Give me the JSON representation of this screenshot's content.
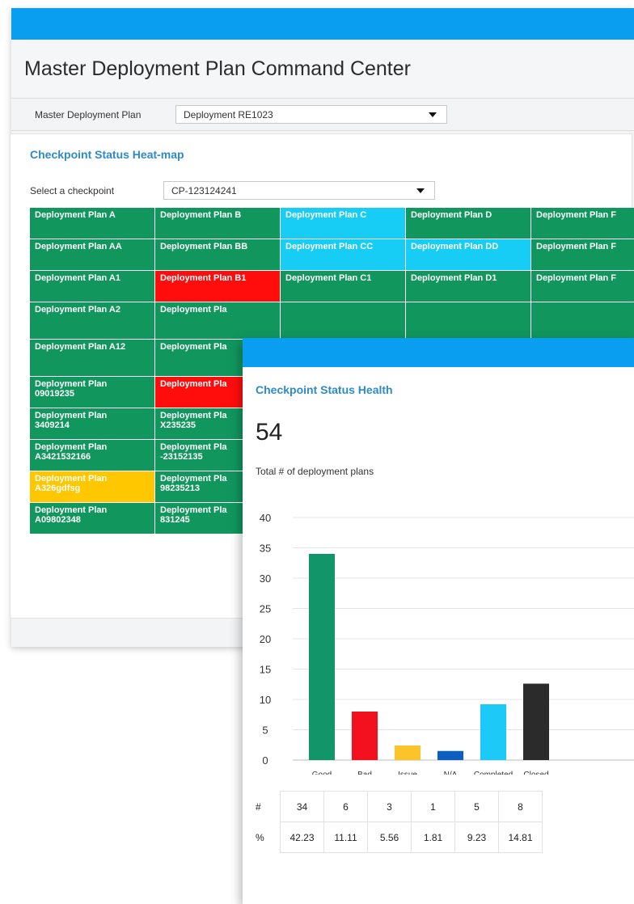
{
  "app": {
    "title": "Master Deployment Plan Command Center"
  },
  "master_plan": {
    "label": "Master Deployment Plan",
    "value": "Deployment RE1023"
  },
  "heatmap": {
    "title": "Checkpoint Status Heat-map",
    "checkpoint_label": "Select a checkpoint",
    "checkpoint_value": "CP-123124241",
    "rows": [
      [
        {
          "t": "Deployment Plan A",
          "c": "g"
        },
        {
          "t": "Deployment Plan B",
          "c": "g"
        },
        {
          "t": "Deployment Plan C",
          "c": "c"
        },
        {
          "t": "Deployment Plan D",
          "c": "g"
        },
        {
          "t": "Deployment Plan F",
          "c": "g"
        }
      ],
      [
        {
          "t": "Deployment Plan AA",
          "c": "g"
        },
        {
          "t": "Deployment Plan BB",
          "c": "g"
        },
        {
          "t": "Deployment Plan CC",
          "c": "c"
        },
        {
          "t": "Deployment Plan DD",
          "c": "c"
        },
        {
          "t": "Deployment Plan F",
          "c": "g"
        }
      ],
      [
        {
          "t": "Deployment Plan A1",
          "c": "g"
        },
        {
          "t": "Deployment Plan B1",
          "c": "r"
        },
        {
          "t": "Deployment Plan C1",
          "c": "g"
        },
        {
          "t": "Deployment Plan D1",
          "c": "g"
        },
        {
          "t": "Deployment Plan F",
          "c": "g"
        }
      ],
      [
        {
          "t": "Deployment Plan A2",
          "c": "g"
        },
        {
          "t": "Deployment Pla",
          "c": "g"
        },
        {
          "t": "",
          "c": "g"
        },
        {
          "t": "",
          "c": "g"
        },
        {
          "t": "",
          "c": "g"
        }
      ],
      [
        {
          "t": "Deployment Plan A12",
          "c": "g"
        },
        {
          "t": "Deployment Pla",
          "c": "g"
        },
        {
          "t": "",
          "c": "g"
        },
        {
          "t": "",
          "c": "g"
        },
        {
          "t": "",
          "c": "g"
        }
      ],
      [
        {
          "t": "Deployment Plan\n09019235",
          "c": "g"
        },
        {
          "t": "Deployment Pla",
          "c": "r"
        },
        {
          "t": "",
          "c": "g"
        },
        {
          "t": "",
          "c": "g"
        },
        {
          "t": "",
          "c": "g"
        }
      ],
      [
        {
          "t": "Deployment Plan\n3409214",
          "c": "g"
        },
        {
          "t": "Deployment Pla\nX235235",
          "c": "g"
        },
        {
          "t": "",
          "c": "g"
        },
        {
          "t": "",
          "c": "g"
        },
        {
          "t": "",
          "c": "g"
        }
      ],
      [
        {
          "t": "Deployment Plan\nA3421532166",
          "c": "g"
        },
        {
          "t": "Deployment Pla\n-23152135",
          "c": "g"
        },
        {
          "t": "",
          "c": "g"
        },
        {
          "t": "",
          "c": "g"
        },
        {
          "t": "",
          "c": "g"
        }
      ],
      [
        {
          "t": "Deployment Plan\nA326gdfsg",
          "c": "y"
        },
        {
          "t": "Deployment Pla\n98235213",
          "c": "g"
        },
        {
          "t": "",
          "c": "g"
        },
        {
          "t": "",
          "c": "g"
        },
        {
          "t": "",
          "c": "g"
        }
      ],
      [
        {
          "t": "Deployment Plan\nA09802348",
          "c": "g"
        },
        {
          "t": "Deployment Pla\n831245",
          "c": "g"
        },
        {
          "t": "",
          "c": "g"
        },
        {
          "t": "",
          "c": "g"
        },
        {
          "t": "",
          "c": "g"
        }
      ]
    ]
  },
  "health": {
    "title": "Checkpoint Status Health",
    "total": "54",
    "total_label": "Total # of deployment plans",
    "count_row_label": "#",
    "pct_row_label": "%",
    "counts": [
      "34",
      "6",
      "3",
      "1",
      "5",
      "8"
    ],
    "percents": [
      "42.23",
      "11.11",
      "5.56",
      "1.81",
      "9.23",
      "14.81"
    ]
  },
  "chart_data": {
    "type": "bar",
    "categories": [
      "Good",
      "Bad",
      "Issue",
      "N/A",
      "Completed",
      "Closed"
    ],
    "values": [
      34,
      8,
      2.4,
      1.5,
      9.2,
      12.6
    ],
    "colors": [
      "#13956a",
      "#f4111f",
      "#fbc42b",
      "#0c5fc1",
      "#1dc9f7",
      "#2b2b2b"
    ],
    "ylim": [
      0,
      40
    ],
    "yticks": [
      0,
      5,
      10,
      15,
      20,
      25,
      30,
      35,
      40
    ],
    "grid": true
  }
}
